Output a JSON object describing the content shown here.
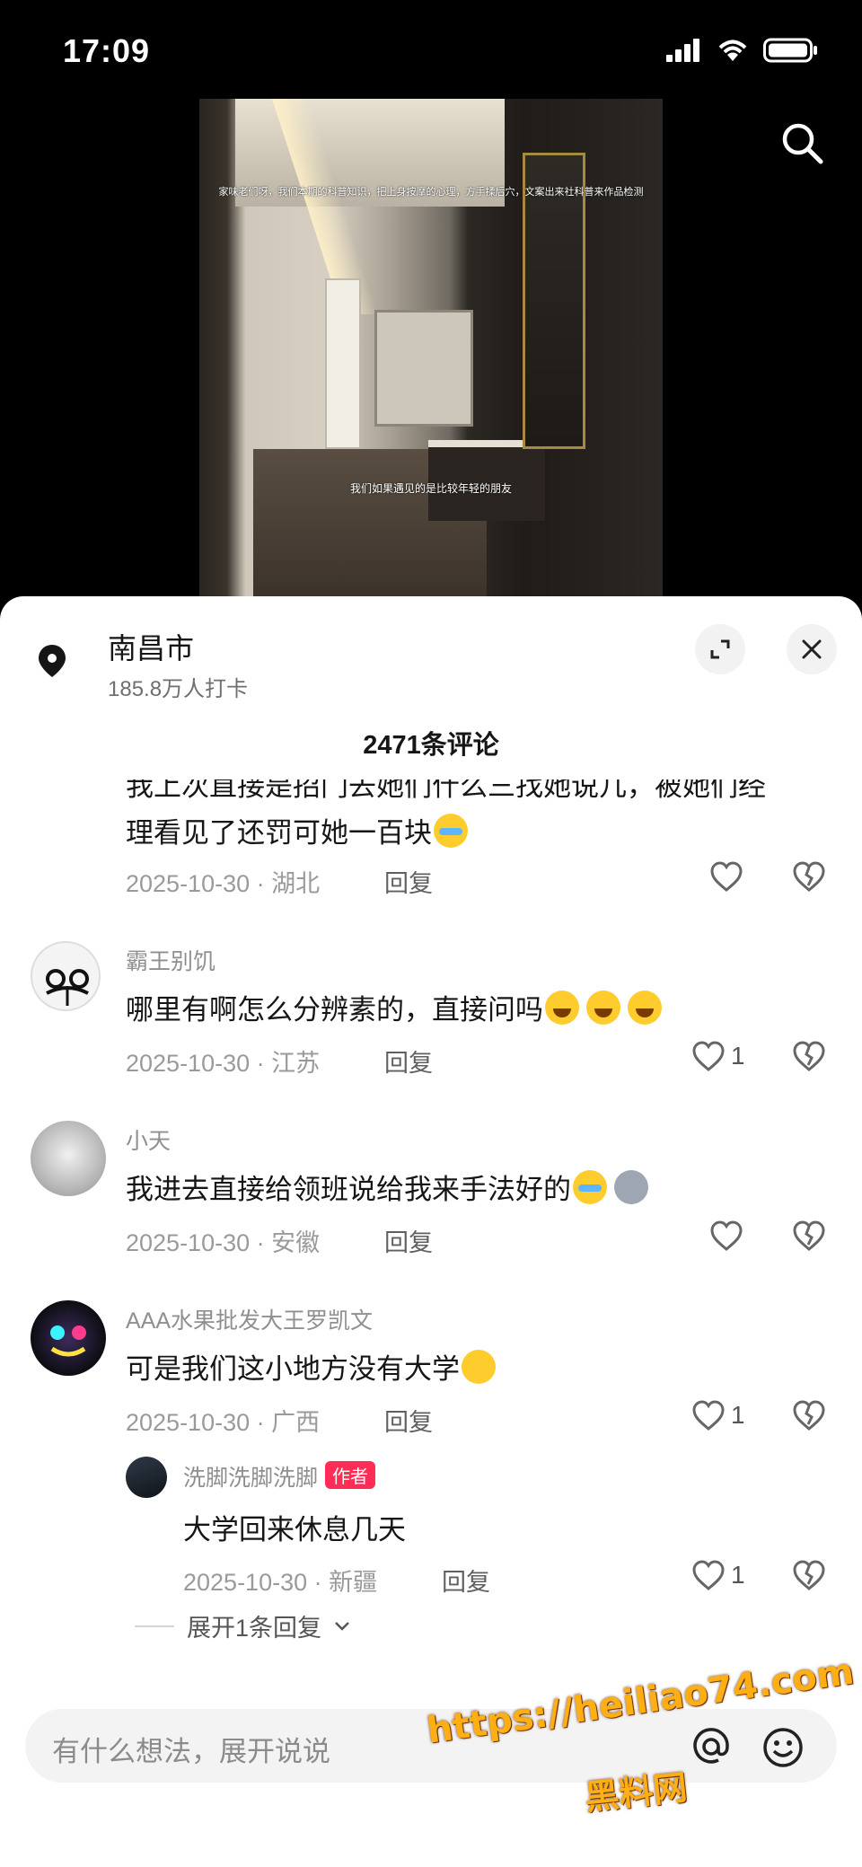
{
  "status_bar": {
    "time": "17:09",
    "icons": [
      "signal-icon",
      "wifi-icon",
      "battery-icon"
    ]
  },
  "video": {
    "caption_top": "家味老们呀，我们本期的科普知识，把上身按摩的心理，方手揉后穴，文案出来社科普来作品检测",
    "caption_bottom": "我们如果遇见的是比较年轻的朋友"
  },
  "location": {
    "title": "南昌市",
    "subtitle": "185.8万人打卡"
  },
  "header": {
    "comment_count": "2471条评论"
  },
  "comments": [
    {
      "partial_line": "我上次直接是招门去她们什么三找她说几，被她们经",
      "text": "理看见了还罚可她一百块",
      "emoji": [
        "cry"
      ],
      "meta": "2025-10-30 · 湖北",
      "reply": "回复",
      "likes": ""
    },
    {
      "name": "霸王别饥",
      "text": "哪里有啊怎么分辨素的，直接问吗",
      "emoji": [
        "grin",
        "grin",
        "grin"
      ],
      "meta": "2025-10-30 · 江苏",
      "reply": "回复",
      "likes": "1"
    },
    {
      "name": "小天",
      "text": "我进去直接给领班说给我来手法好的",
      "emoji": [
        "cry",
        "husky"
      ],
      "meta": "2025-10-30 · 安徽",
      "reply": "回复",
      "likes": ""
    },
    {
      "name": "AAA水果批发大王罗凯文",
      "text": "可是我们这小地方没有大学",
      "emoji": [
        "pleading"
      ],
      "meta": "2025-10-30 · 广西",
      "reply": "回复",
      "likes": "1"
    },
    {
      "name": "洗脚洗脚洗脚",
      "badge": "作者",
      "text": "大学回来休息几天",
      "meta": "2025-10-30 · 新疆",
      "reply": "回复",
      "likes": "1"
    }
  ],
  "expand_replies": "展开1条回复",
  "input": {
    "placeholder": "有什么想法，展开说说"
  },
  "watermark": {
    "line1": "https://heiliao74.com",
    "line2": "黑料网"
  },
  "colors": {
    "sheet_bg": "#ffffff",
    "author_badge": "#ff2d55",
    "watermark": "#ffae13"
  }
}
